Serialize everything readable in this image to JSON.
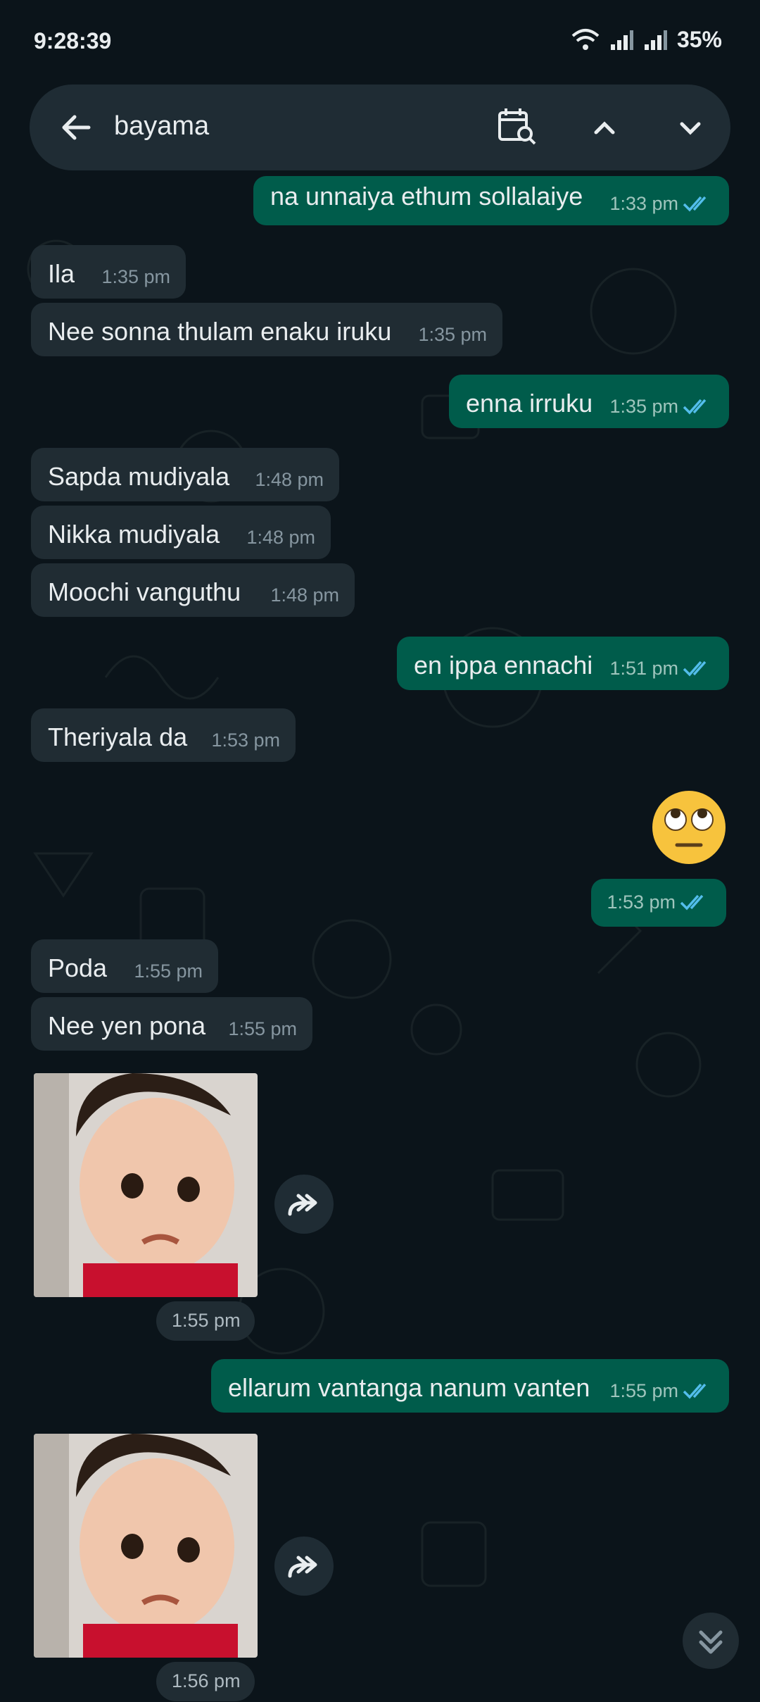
{
  "status": {
    "time": "9:28:39",
    "battery": "35%"
  },
  "search": {
    "query": "bayama"
  },
  "messages": [
    {
      "dir": "out",
      "text": "na unnaiya ethum sollalaiye",
      "time": "1:33 pm"
    },
    {
      "dir": "in",
      "text": "Ila",
      "time": "1:35 pm"
    },
    {
      "dir": "in",
      "text": "Nee sonna thulam enaku iruku",
      "time": "1:35 pm"
    },
    {
      "dir": "out",
      "text": "enna irruku",
      "time": "1:35 pm"
    },
    {
      "dir": "in",
      "text": "Sapda mudiyala",
      "time": "1:48 pm"
    },
    {
      "dir": "in",
      "text": "Nikka mudiyala",
      "time": "1:48 pm"
    },
    {
      "dir": "in",
      "text": "Moochi vanguthu",
      "time": "1:48 pm"
    },
    {
      "dir": "out",
      "text": "en ippa ennachi",
      "time": "1:51 pm"
    },
    {
      "dir": "in",
      "text": "Theriyala da",
      "time": "1:53 pm"
    },
    {
      "dir": "out",
      "text": "",
      "time": "1:53 pm",
      "emoji": "face-with-rolling-eyes"
    },
    {
      "dir": "in",
      "text": "Poda",
      "time": "1:55 pm"
    },
    {
      "dir": "in",
      "text": "Nee yen pona",
      "time": "1:55 pm"
    },
    {
      "dir": "in",
      "text": "",
      "time": "1:55 pm",
      "media": "sticker-image"
    },
    {
      "dir": "out",
      "text": "ellarum vantanga nanum vanten",
      "time": "1:55 pm"
    },
    {
      "dir": "in",
      "text": "",
      "time": "1:56 pm",
      "media": "sticker-image"
    }
  ],
  "colors": {
    "incoming": "#202c33",
    "outgoing": "#005c4b",
    "read_ticks": "#53bdeb",
    "background": "#0b141a"
  }
}
